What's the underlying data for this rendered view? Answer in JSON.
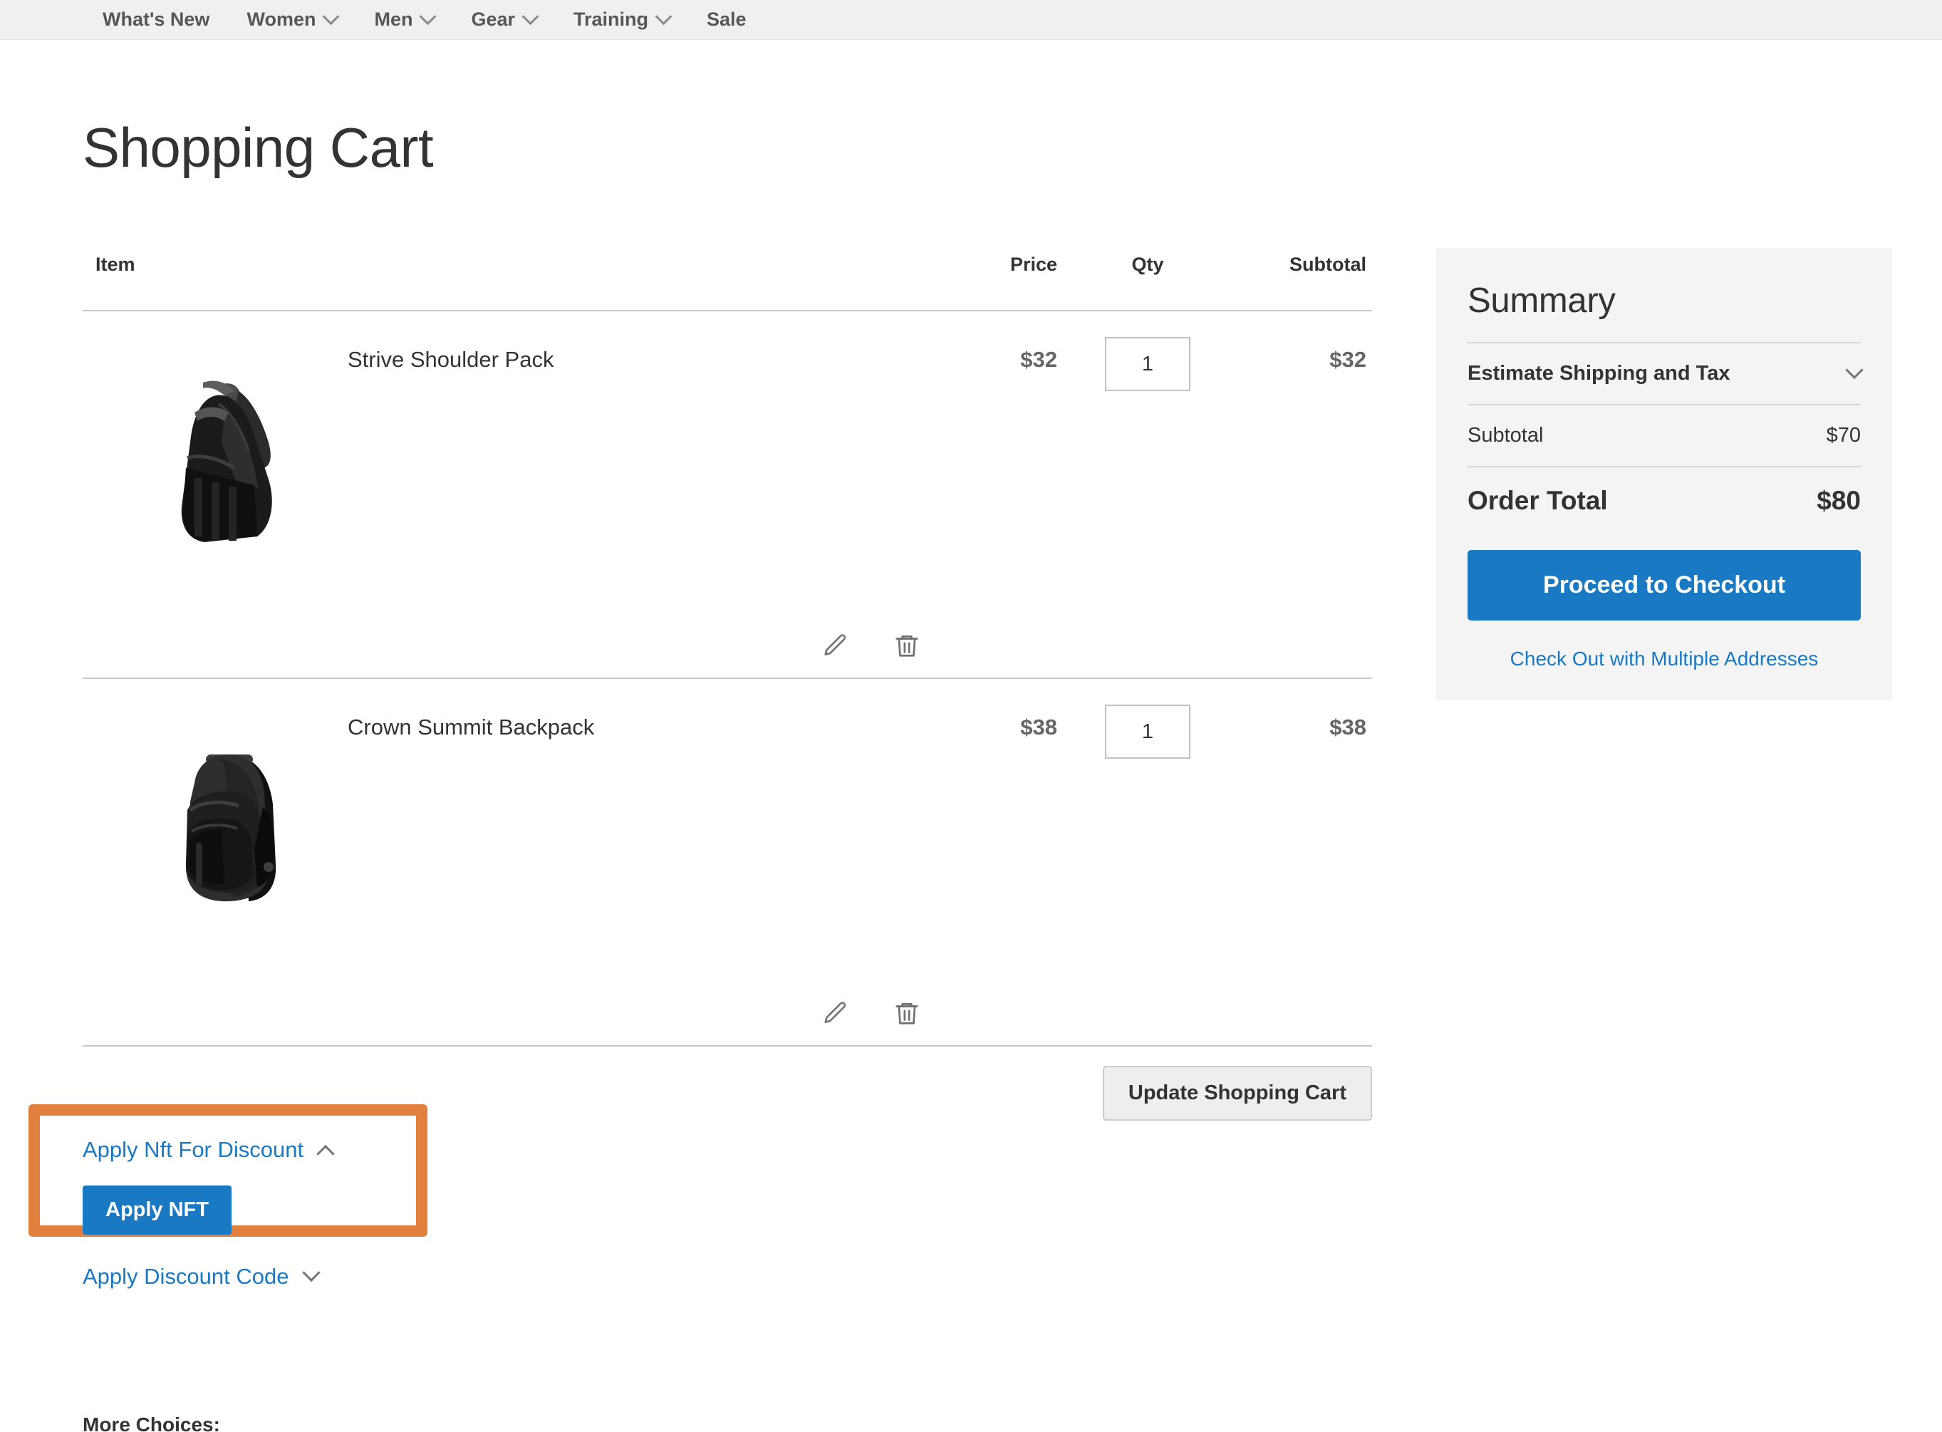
{
  "nav": {
    "items": [
      {
        "label": "What's New",
        "has_dropdown": false
      },
      {
        "label": "Women",
        "has_dropdown": true
      },
      {
        "label": "Men",
        "has_dropdown": true
      },
      {
        "label": "Gear",
        "has_dropdown": true
      },
      {
        "label": "Training",
        "has_dropdown": true
      },
      {
        "label": "Sale",
        "has_dropdown": false
      }
    ]
  },
  "page": {
    "title": "Shopping Cart",
    "more_choices_label": "More Choices:"
  },
  "cart": {
    "headers": {
      "item": "Item",
      "price": "Price",
      "qty": "Qty",
      "subtotal": "Subtotal"
    },
    "rows": [
      {
        "name": "Strive Shoulder Pack",
        "price": "$32",
        "qty": "1",
        "subtotal": "$32",
        "edit_icon": "pencil-icon",
        "delete_icon": "trash-icon"
      },
      {
        "name": "Crown Summit Backpack",
        "price": "$38",
        "qty": "1",
        "subtotal": "$38",
        "edit_icon": "pencil-icon",
        "delete_icon": "trash-icon"
      }
    ],
    "update_label": "Update Shopping Cart"
  },
  "discounts": {
    "nft_toggle_label": "Apply Nft For Discount",
    "nft_toggle_state": "expanded",
    "nft_button_label": "Apply NFT",
    "code_toggle_label": "Apply Discount Code",
    "code_toggle_state": "collapsed",
    "highlight_color": "#e2813e"
  },
  "summary": {
    "title": "Summary",
    "shipping_label": "Estimate Shipping and Tax",
    "subtotal_label": "Subtotal",
    "subtotal_value": "$70",
    "total_label": "Order Total",
    "total_value": "$80",
    "checkout_label": "Proceed to Checkout",
    "multi_address_label": "Check Out with Multiple Addresses",
    "accent_color": "#1979c3",
    "panel_color": "#f4f4f4"
  }
}
